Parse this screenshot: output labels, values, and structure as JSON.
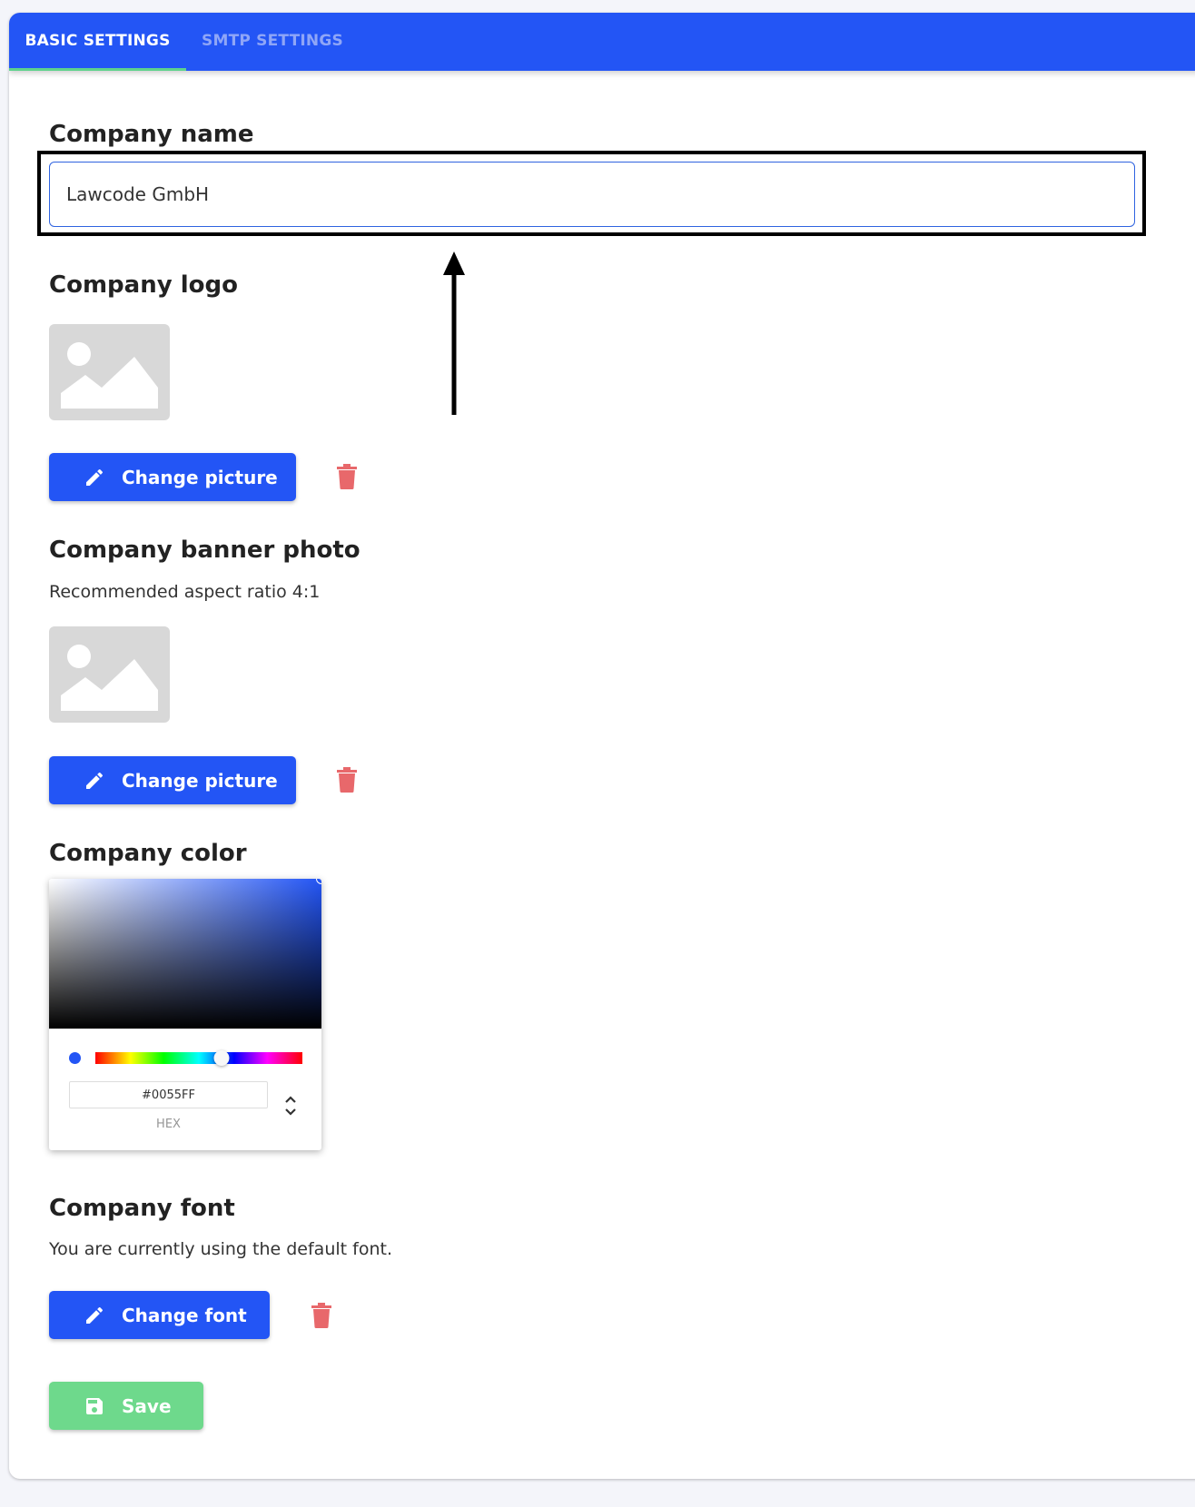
{
  "tabs": [
    {
      "label": "BASIC SETTINGS",
      "active": true
    },
    {
      "label": "SMTP SETTINGS",
      "active": false
    }
  ],
  "company_name": {
    "heading": "Company name",
    "value": "Lawcode GmbH"
  },
  "company_logo": {
    "heading": "Company logo",
    "button_label": "Change picture"
  },
  "company_banner": {
    "heading": "Company banner photo",
    "description": "Recommended aspect ratio 4:1",
    "button_label": "Change picture"
  },
  "company_color": {
    "heading": "Company color",
    "hex_value": "#0055FF",
    "hex_label": "HEX",
    "hue_fraction": 0.61,
    "color": "#2355f5"
  },
  "company_font": {
    "heading": "Company font",
    "description": "You are currently using the default font.",
    "button_label": "Change font"
  },
  "save_label": "Save",
  "colors": {
    "primary": "#2355f5",
    "success": "#6ed98c",
    "danger": "#e8686b",
    "tab_indicator": "#5ed28c"
  }
}
